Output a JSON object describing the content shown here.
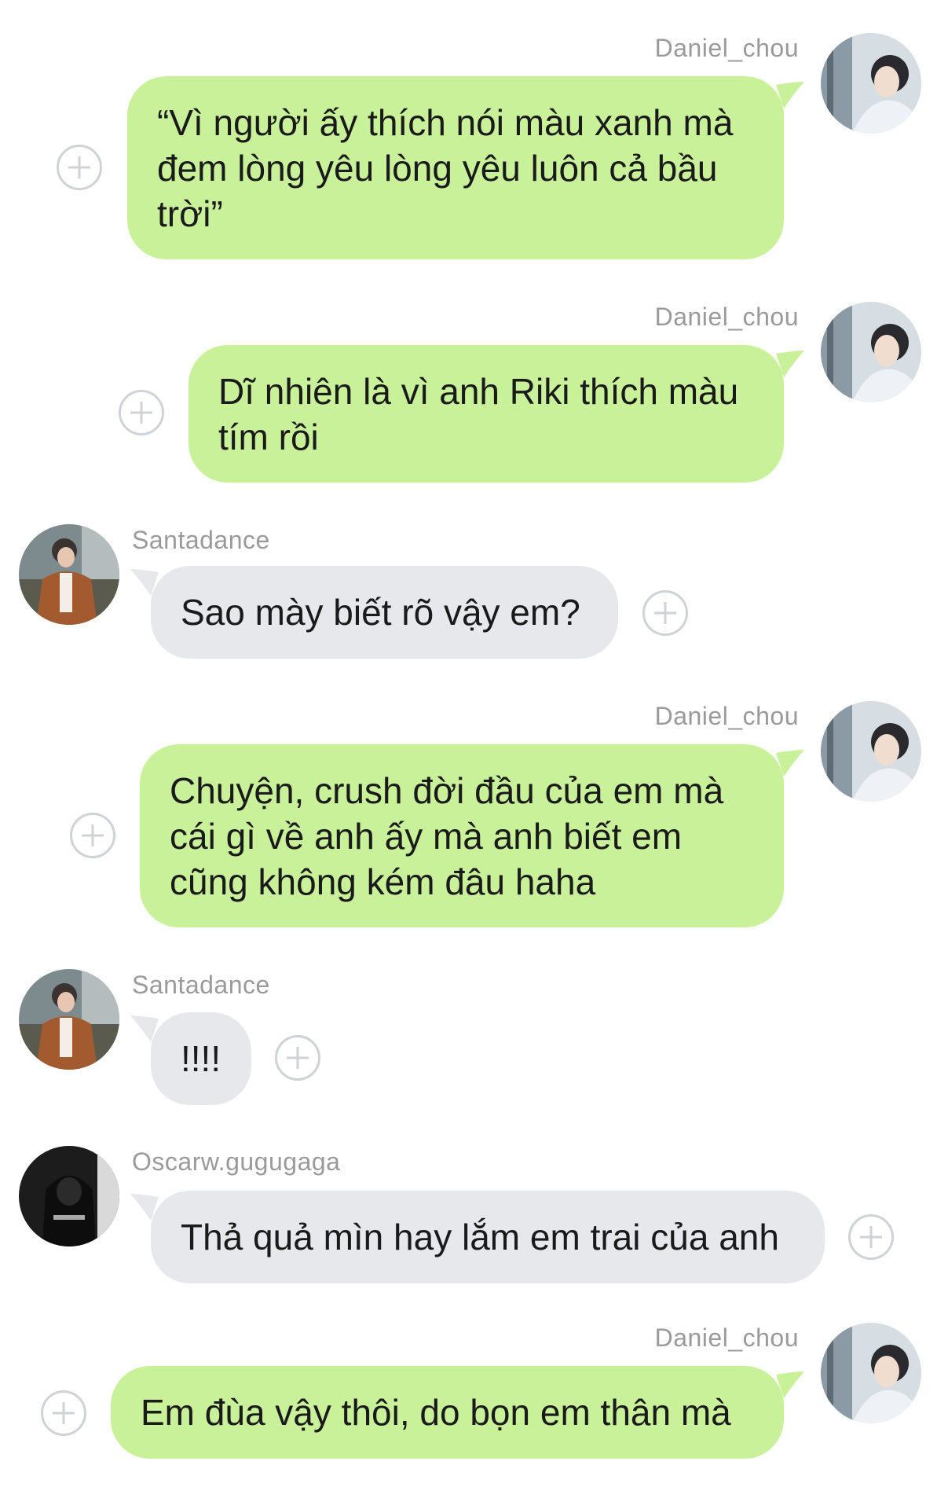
{
  "messages": [
    {
      "sender": "Daniel_chou",
      "side": "right",
      "text": "“Vì người ấy thích nói màu xanh mà\nđem lòng yêu lòng yêu luôn cả bầu\ntrời”"
    },
    {
      "sender": "Daniel_chou",
      "side": "right",
      "text": "Dĩ nhiên là vì anh Riki thích màu\ntím rồi"
    },
    {
      "sender": "Santadance",
      "side": "left",
      "text": "Sao mày biết rõ vậy em?"
    },
    {
      "sender": "Daniel_chou",
      "side": "right",
      "text": "Chuyện, crush đời đầu của em mà\ncái gì về anh ấy mà anh biết em\ncũng không kém đâu haha"
    },
    {
      "sender": "Santadance",
      "side": "left",
      "text": "!!!!"
    },
    {
      "sender": "Oscarw.gugugaga",
      "side": "left",
      "text": "Thả quả mìn hay lắm em trai của anh"
    },
    {
      "sender": "Daniel_chou",
      "side": "right",
      "text": "Em đùa vậy thôi, do bọn em thân mà"
    }
  ],
  "colors": {
    "outgoing_bubble": "#c9f19a",
    "incoming_bubble": "#e6e8eb",
    "sender_name": "#9a9a9a",
    "add_icon": "#cfd2d6"
  },
  "icons": {
    "add_reaction": "plus-circle-icon"
  }
}
